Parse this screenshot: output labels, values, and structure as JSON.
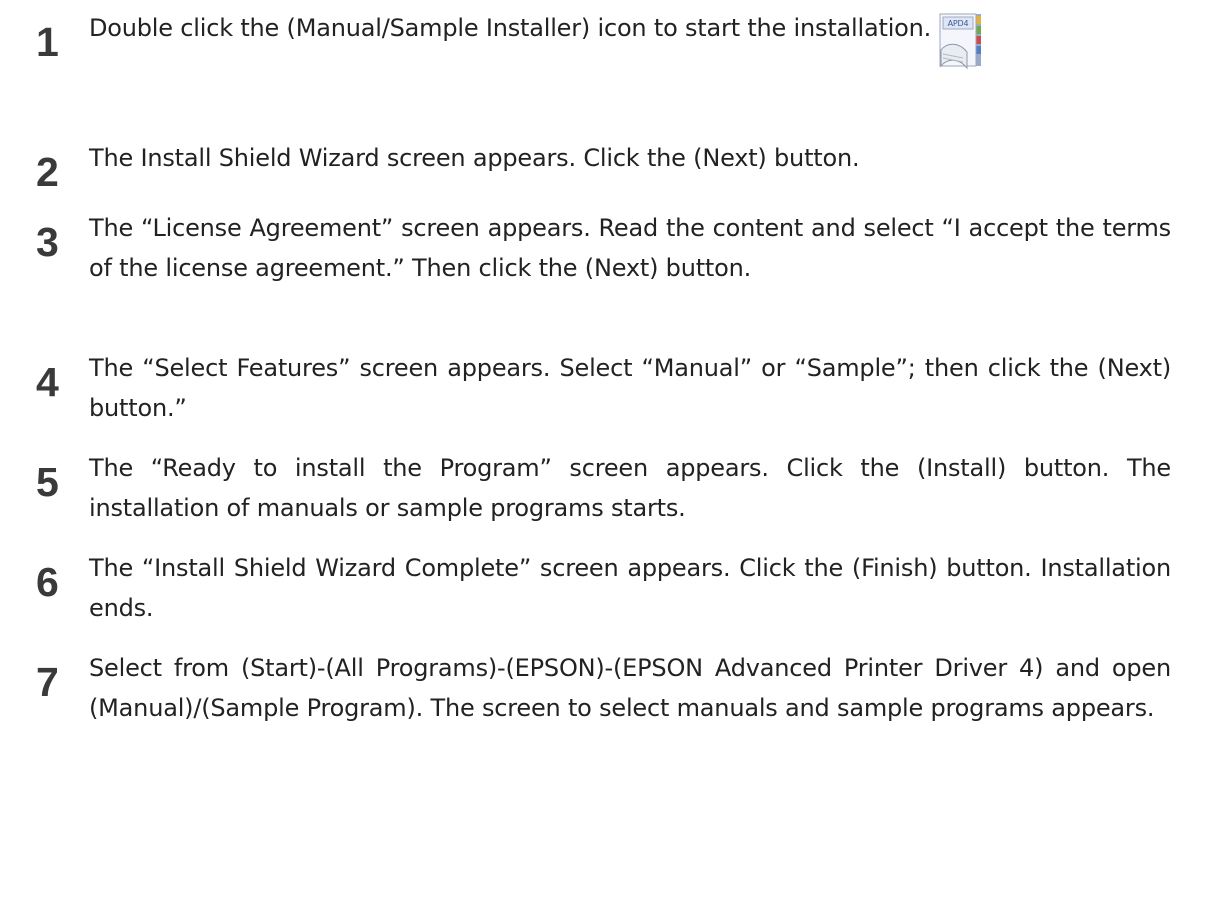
{
  "steps": [
    {
      "number": "1",
      "text": "Double click the (Manual/Sample Installer) icon to start the installation."
    },
    {
      "number": "2",
      "text": "The Install Shield Wizard screen appears. Click the (Next) button."
    },
    {
      "number": "3",
      "text": "The “License Agreement” screen appears. Read the content and select “I accept the terms of the license agreement.” Then click the (Next) button."
    },
    {
      "number": "4",
      "text": "The “Select Features” screen appears. Select “Manual” or “Sample”; then click the (Next) button.”"
    },
    {
      "number": "5",
      "text": "The “Ready to install the Program” screen appears. Click the (Install) button. The installation of manuals or sample programs starts."
    },
    {
      "number": "6",
      "text": "The “Install Shield Wizard Complete” screen appears. Click the (Finish) button. Installation ends."
    },
    {
      "number": "7",
      "text": "Select from (Start)-(All Programs)-(EPSON)-(EPSON Advanced Printer Driver 4) and open (Manual)/(Sample Program). The screen to select manuals and sample programs appears."
    }
  ],
  "installer_icon": {
    "label": "APD4",
    "icon": "installer-document-icon"
  }
}
